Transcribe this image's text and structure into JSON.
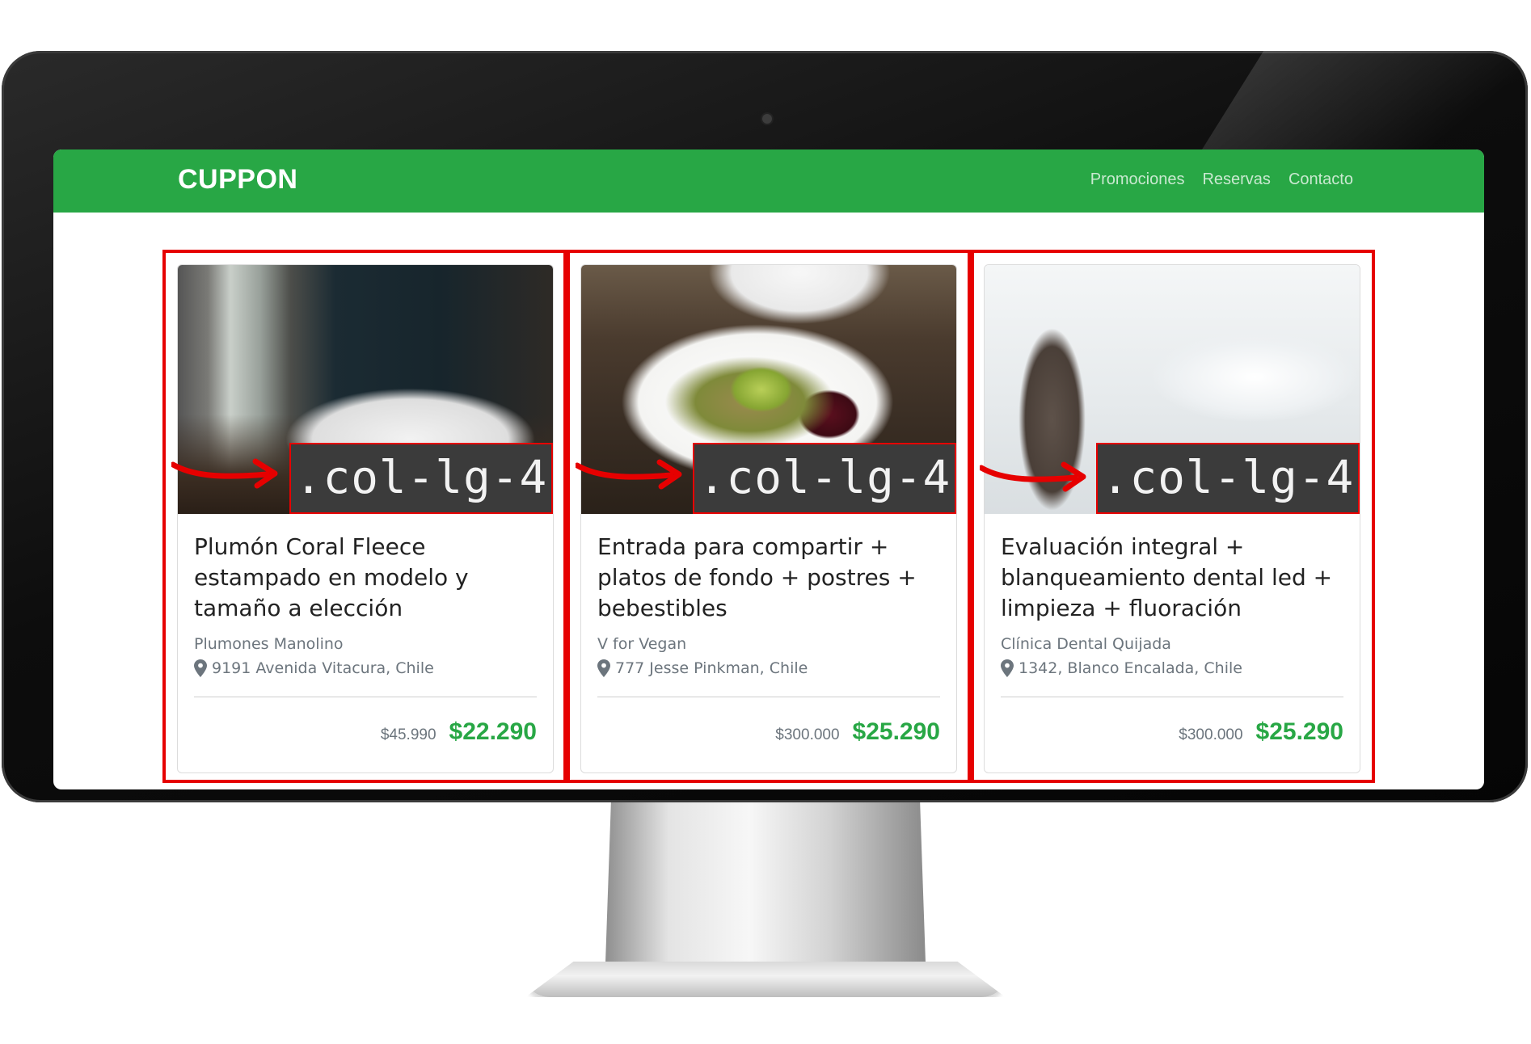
{
  "navbar": {
    "brand": "CUPPON",
    "links": [
      "Promociones",
      "Reservas",
      "Contacto"
    ]
  },
  "colors": {
    "navbar_bg": "#28a745",
    "price_new": "#28a745",
    "annotation_red": "#e60000",
    "code_label_bg": "#3b3b3b"
  },
  "annotation": {
    "label": ".col-lg-4"
  },
  "cards": [
    {
      "image": "bedroom-photo",
      "title": "Plumón Coral Fleece estampado en modelo y tamaño a elección",
      "merchant": "Plumones Manolino",
      "location": "9191 Avenida Vitacura, Chile",
      "old_price": "$45.990",
      "new_price": "$22.290"
    },
    {
      "image": "food-plate-photo",
      "title": "Entrada para compartir + platos de fondo + postres + bebestibles",
      "merchant": "V for Vegan",
      "location": "777 Jesse Pinkman, Chile",
      "old_price": "$300.000",
      "new_price": "$25.290"
    },
    {
      "image": "dental-chair-photo",
      "title": "Evaluación integral + blanqueamiento dental led + limpieza + fluoración",
      "merchant": "Clínica Dental Quijada",
      "location": "1342, Blanco Encalada, Chile",
      "old_price": "$300.000",
      "new_price": "$25.290"
    }
  ]
}
